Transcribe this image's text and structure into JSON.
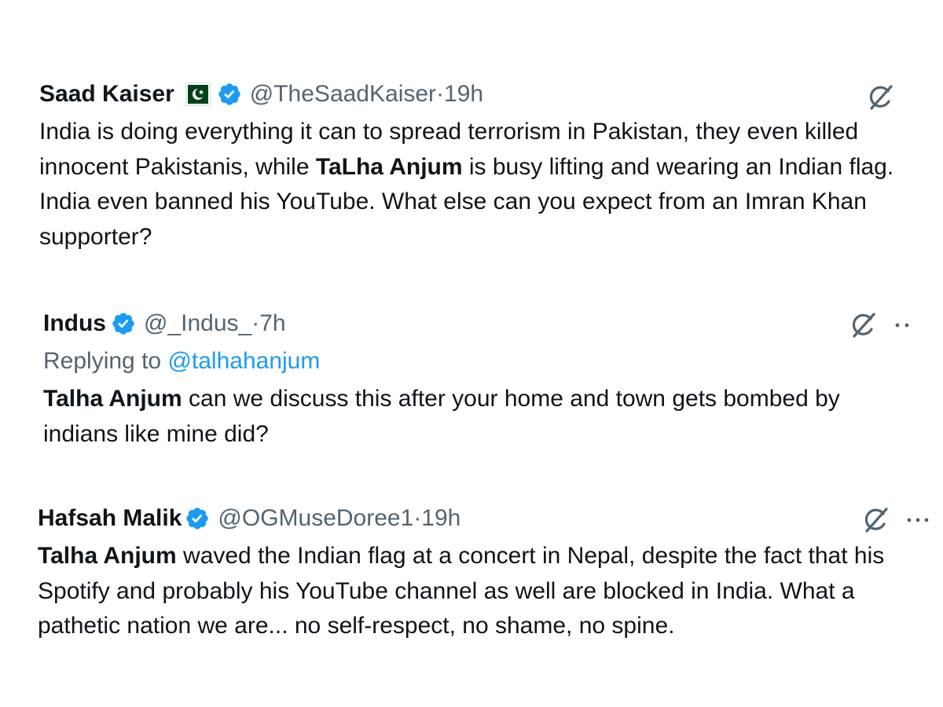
{
  "tweets": [
    {
      "name": "Saad Kaiser",
      "handle": "@TheSaadKaiser",
      "sep": " · ",
      "time": "19h",
      "has_flag": true,
      "has_more": false,
      "body_bold": "TaLha Anjum",
      "body_before": "India is doing everything it can to spread terrorism in Pakistan, they even killed innocent Pakistanis, while ",
      "body_after": " is busy lifting and wearing an Indian flag. India even banned his YouTube. What else can you expect from an Imran Khan supporter?"
    },
    {
      "name": "Indus",
      "handle": "@_Indus_",
      "sep": " · ",
      "time": "7h",
      "has_flag": false,
      "has_more": true,
      "replying_prefix": "Replying to ",
      "replying_handle": "@talhahanjum",
      "body_bold": "Talha Anjum",
      "body_before": "",
      "body_after": " can we discuss this after your home and town gets bombed by indians like mine did?"
    },
    {
      "name": "Hafsah Malik",
      "handle": "@OGMuseDoree1",
      "sep": " · ",
      "time": "19h",
      "has_flag": false,
      "has_more": true,
      "body_bold": "Talha Anjum",
      "body_before": "",
      "body_after": " waved the Indian flag at a concert in Nepal, despite the fact that his Spotify and probably his YouTube channel as well are blocked in India. What a pathetic nation we are... no self-respect, no shame, no spine."
    }
  ],
  "icons": {
    "verified": "verified-badge-icon",
    "grok": "grok-icon",
    "more": "more-options-icon",
    "flag": "pakistan-flag-icon"
  },
  "colors": {
    "verified_blue": "#1d9bf0",
    "handle_gray": "#536471",
    "text": "#0f1419",
    "flag_green": "#01411c"
  }
}
